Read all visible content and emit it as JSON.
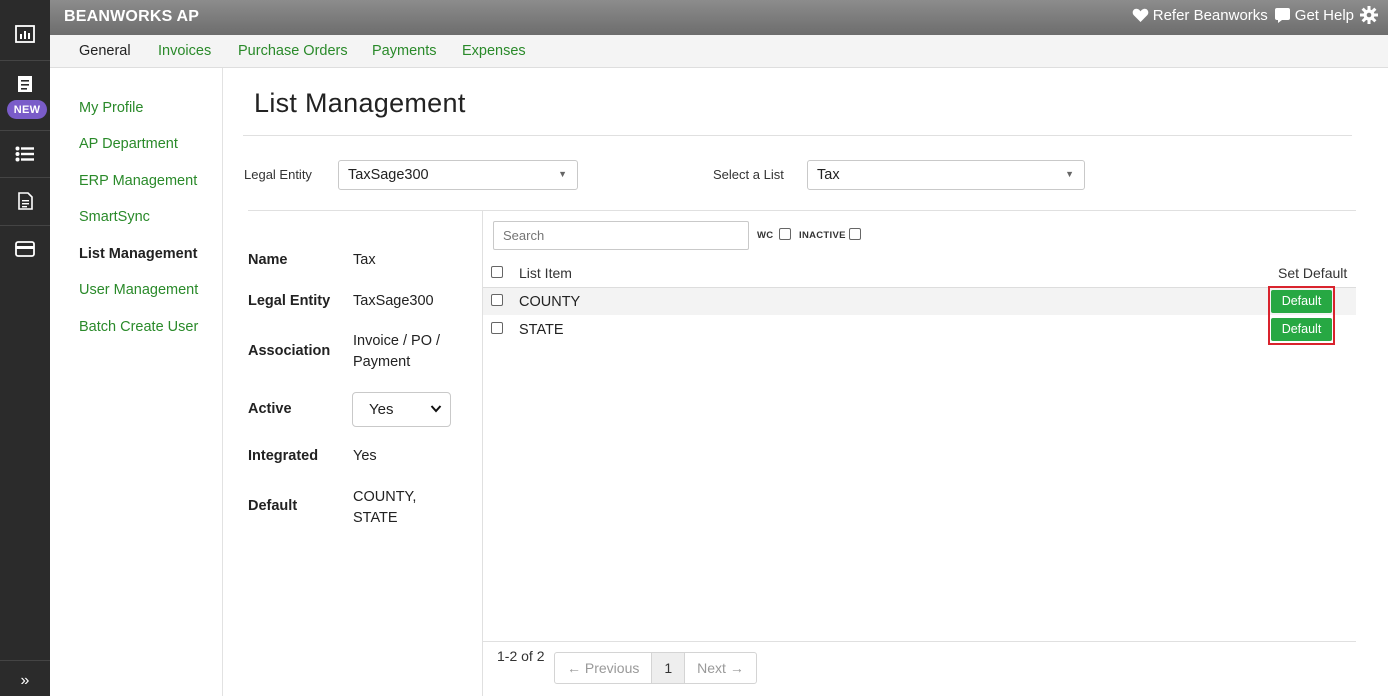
{
  "header": {
    "brand": "BEANWORKS AP",
    "refer": "Refer Beanworks",
    "help": "Get Help"
  },
  "rail": {
    "new_badge": "NEW",
    "collapse": "»"
  },
  "tabs": [
    "General",
    "Invoices",
    "Purchase Orders",
    "Payments",
    "Expenses"
  ],
  "sidebar": {
    "items": [
      {
        "label": "My Profile"
      },
      {
        "label": "AP Department"
      },
      {
        "label": "ERP Management"
      },
      {
        "label": "SmartSync"
      },
      {
        "label": "List Management"
      },
      {
        "label": "User Management"
      },
      {
        "label": "Batch Create User"
      }
    ]
  },
  "page": {
    "title": "List Management",
    "legal_entity_label": "Legal Entity",
    "legal_entity_value": "TaxSage300",
    "select_list_label": "Select a List",
    "select_list_value": "Tax"
  },
  "details": {
    "name_label": "Name",
    "name_value": "Tax",
    "entity_label": "Legal Entity",
    "entity_value": "TaxSage300",
    "assoc_label": "Association",
    "assoc_line1": "Invoice / PO /",
    "assoc_line2": "Payment",
    "active_label": "Active",
    "active_value": "Yes",
    "integrated_label": "Integrated",
    "integrated_value": "Yes",
    "default_label": "Default",
    "default_line1": "COUNTY,",
    "default_line2": "STATE"
  },
  "list": {
    "search_placeholder": "Search",
    "wc_label": "WC",
    "inactive_label": "INACTIVE",
    "col_item": "List Item",
    "col_default": "Set Default",
    "rows": [
      {
        "item": "COUNTY",
        "button": "Default"
      },
      {
        "item": "STATE",
        "button": "Default"
      }
    ]
  },
  "pagination": {
    "count": "1-2 of 2",
    "prev": "← Previous",
    "page": "1",
    "next": "Next →"
  }
}
